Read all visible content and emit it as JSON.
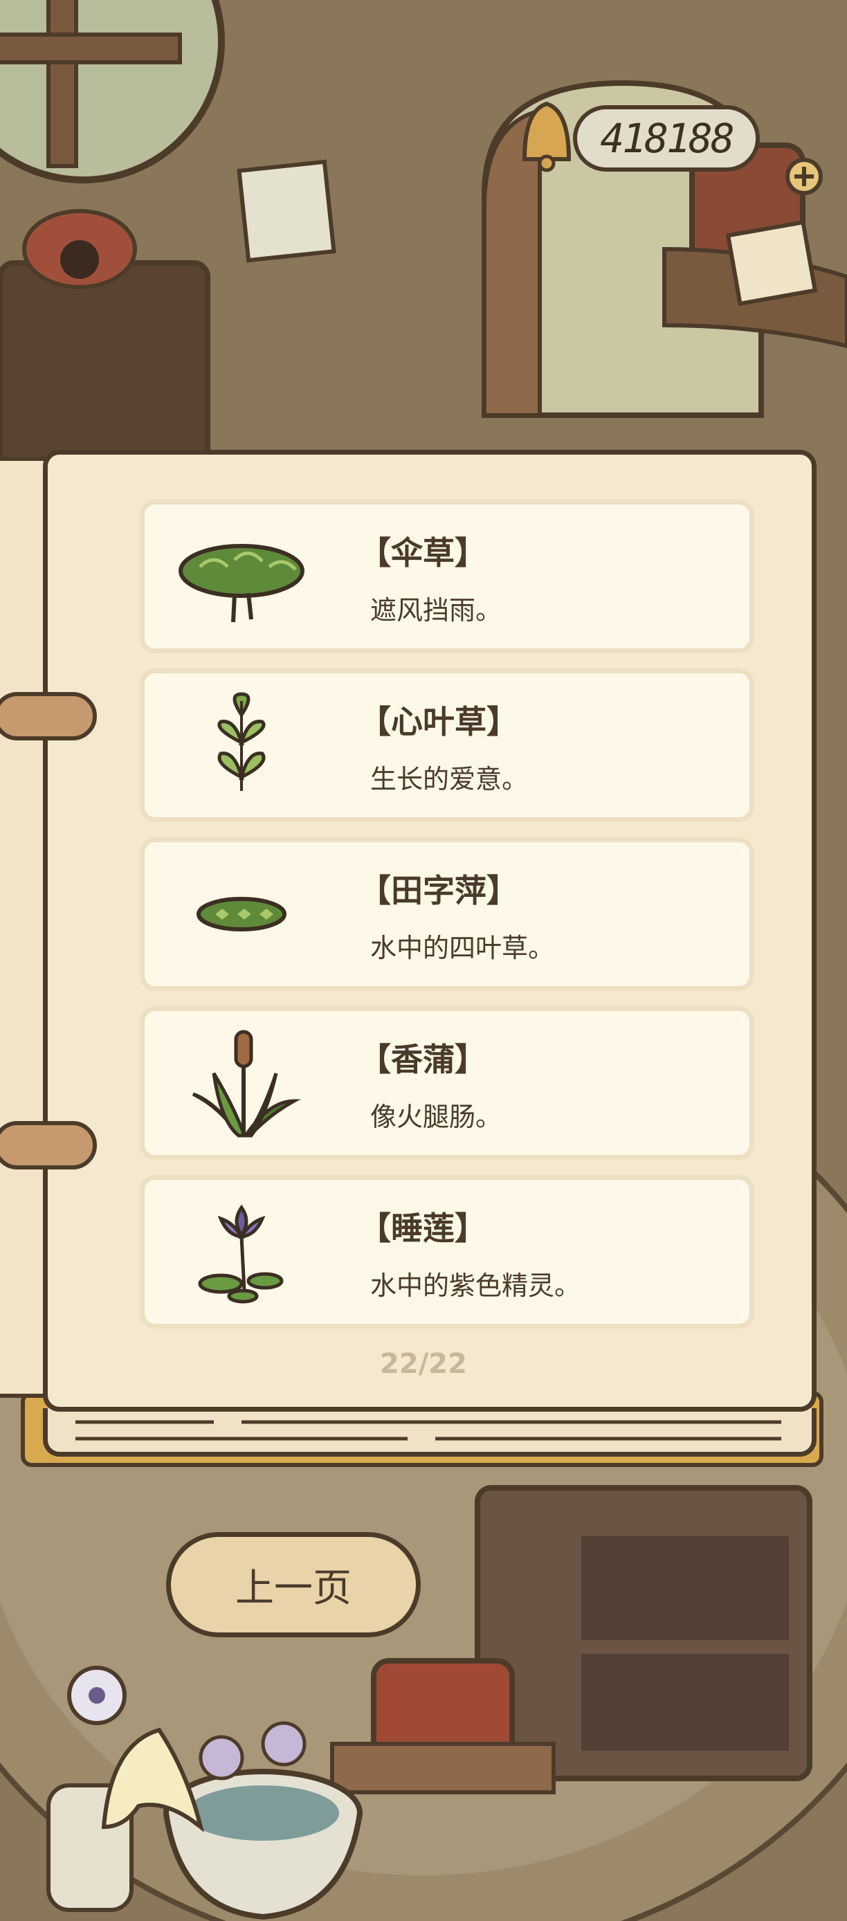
{
  "currency": {
    "amount": "418188",
    "add_icon": "plus-circle-icon",
    "bell_icon": "bell-icon"
  },
  "items": [
    {
      "name": "【伞草】",
      "desc": "遮风挡雨。",
      "icon": "umbrella-grass-icon"
    },
    {
      "name": "【心叶草】",
      "desc": "生长的爱意。",
      "icon": "heart-leaf-icon"
    },
    {
      "name": "【田字萍】",
      "desc": "水中的四叶草。",
      "icon": "water-clover-icon"
    },
    {
      "name": "【香蒲】",
      "desc": "像火腿肠。",
      "icon": "cattail-icon"
    },
    {
      "name": "【睡莲】",
      "desc": "水中的紫色精灵。",
      "icon": "water-lily-icon"
    }
  ],
  "pager": "22/22",
  "prev_button": "上一页",
  "colors": {
    "page": "#f4e8cf",
    "card": "#fdf8e8",
    "outline": "#4d3b2a",
    "button": "#e9d3a8",
    "book_edge": "#d8a94e"
  }
}
